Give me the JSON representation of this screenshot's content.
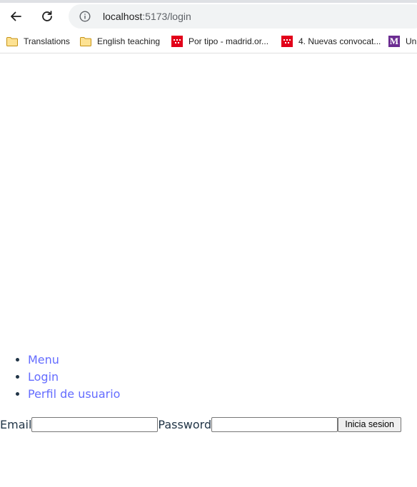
{
  "browser": {
    "url_host": "localhost",
    "url_path": ":5173/login",
    "bookmarks": [
      {
        "label": "Translations",
        "icon": "folder-icon"
      },
      {
        "label": "English teaching",
        "icon": "folder-icon"
      },
      {
        "label": "Por tipo - madrid.or...",
        "icon": "comunidad-madrid-icon"
      },
      {
        "label": "4. Nuevas convocat...",
        "icon": "comunidad-madrid-icon"
      },
      {
        "label": "Un",
        "icon": "m-logo-icon",
        "logo_letter": "M"
      }
    ]
  },
  "nav": {
    "items": [
      "Menu",
      "Login",
      "Perfil de usuario"
    ],
    "link_color": "#646cff"
  },
  "form": {
    "email_label": "Email",
    "email_value": "",
    "password_label": "Password",
    "password_value": "",
    "submit_label": "Inicia sesion"
  }
}
